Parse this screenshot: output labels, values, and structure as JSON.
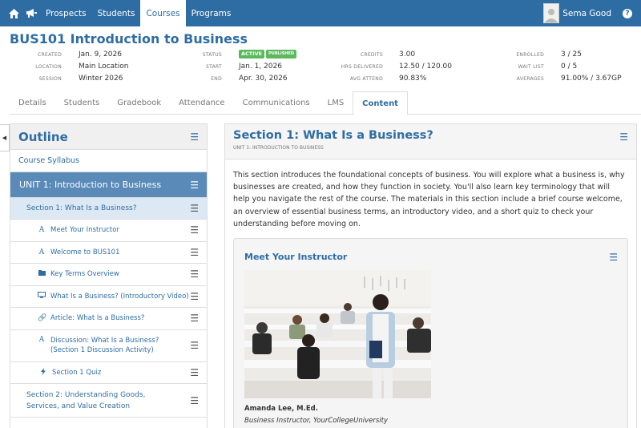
{
  "nav": {
    "items": [
      {
        "label": "Prospects",
        "active": false
      },
      {
        "label": "Students",
        "active": false
      },
      {
        "label": "Courses",
        "active": true
      },
      {
        "label": "Programs",
        "active": false
      }
    ],
    "user_name": "Sema Good",
    "help_label": "?"
  },
  "course": {
    "title": "BUS101 Introduction to Business",
    "meta": {
      "created_label": "Created",
      "created": "Jan. 9, 2026",
      "location_label": "Location",
      "location": "Main Location",
      "session_label": "Session",
      "session": "Winter 2026",
      "status_label": "Status",
      "status_badge": "ACTIVE",
      "published_badge": "PUBLISHED",
      "start_label": "Start",
      "start": "Jan. 1, 2026",
      "end_label": "End",
      "end": "Apr. 30, 2026",
      "credits_label": "Credits",
      "credits": "3.00",
      "hrs_label": "Hrs Delivered",
      "hrs": "12.50 / 120.00",
      "attend_label": "Avg Attend",
      "attend": "90.83%",
      "enrolled_label": "Enrolled",
      "enrolled": "3 / 25",
      "waitlist_label": "Wait List",
      "waitlist": "0 / 5",
      "averages_label": "Averages",
      "averages": "91.00% / 3.67GP"
    }
  },
  "tabs": [
    {
      "label": "Details",
      "active": false
    },
    {
      "label": "Students",
      "active": false
    },
    {
      "label": "Gradebook",
      "active": false
    },
    {
      "label": "Attendance",
      "active": false
    },
    {
      "label": "Communications",
      "active": false
    },
    {
      "label": "LMS",
      "active": false
    },
    {
      "label": "Content",
      "active": true
    }
  ],
  "outline": {
    "title": "Outline",
    "syllabus": "Course Syllabus",
    "unit": "UNIT 1: Introduction to Business",
    "section_active": "Section 1: What Is a Business?",
    "subitems": [
      {
        "icon": "text-icon",
        "label": "Meet Your Instructor"
      },
      {
        "icon": "text-icon",
        "label": "Welcome to BUS101"
      },
      {
        "icon": "folder-icon",
        "label": "Key Terms Overview"
      },
      {
        "icon": "video-icon",
        "label": "What Is a Business? (Introductory Video)"
      },
      {
        "icon": "link-icon",
        "label": "Article: What Is a Business?"
      },
      {
        "icon": "text-icon",
        "label": "Discussion: What Is a Business? (Section 1 Discussion Activity)"
      },
      {
        "icon": "bolt-icon",
        "label": "Section 1 Quiz"
      }
    ],
    "section2": "Section 2: Understanding Goods, Services, and Value Creation"
  },
  "content": {
    "title": "Section 1: What Is a Business?",
    "subtitle": "UNIT 1: INTRODUCTION TO BUSINESS",
    "body": "This section introduces the foundational concepts of business. You will explore what a business is, why businesses are created, and how they function in society. You'll also learn key terminology that will help you navigate the rest of the course. The materials in this section include a brief course welcome, an overview of essential business terms, an introductory video, and a short quiz to check your understanding before moving on.",
    "card": {
      "title": "Meet Your Instructor",
      "name": "Amanda Lee, M.Ed.",
      "role": "Business Instructor, YourCollegeUniversity"
    }
  },
  "colors": {
    "brand": "#2e6da4",
    "unit_bg": "#5a8ab8",
    "section_bg": "#dce8f3",
    "badge": "#5cb85c"
  }
}
